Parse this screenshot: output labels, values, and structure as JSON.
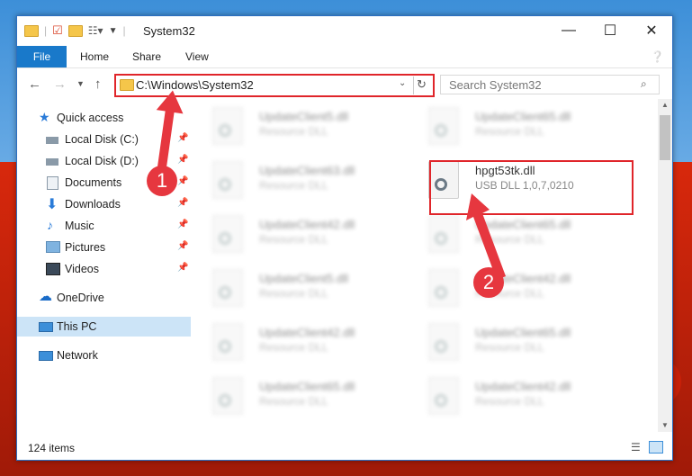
{
  "window": {
    "title": "System32",
    "controls": {
      "minimize": "—",
      "maximize": "☐",
      "close": "✕"
    }
  },
  "ribbon": {
    "tabs": [
      "File",
      "Home",
      "Share",
      "View"
    ]
  },
  "address": {
    "path": "C:\\Windows\\System32",
    "search_placeholder": "Search System32"
  },
  "sidebar": {
    "items": [
      {
        "label": "Quick access",
        "icon": "star-icon"
      },
      {
        "label": "Local Disk (C:)",
        "icon": "drive-icon"
      },
      {
        "label": "Local Disk (D:)",
        "icon": "drive-icon"
      },
      {
        "label": "Documents",
        "icon": "documents-icon"
      },
      {
        "label": "Downloads",
        "icon": "download-icon"
      },
      {
        "label": "Music",
        "icon": "music-icon"
      },
      {
        "label": "Pictures",
        "icon": "pictures-icon"
      },
      {
        "label": "Videos",
        "icon": "videos-icon"
      },
      {
        "label": "OneDrive",
        "icon": "cloud-icon"
      },
      {
        "label": "This PC",
        "icon": "computer-icon"
      },
      {
        "label": "Network",
        "icon": "network-icon"
      }
    ]
  },
  "files": [
    {
      "name": "UpdateClient5.dll",
      "type": "Resource DLL"
    },
    {
      "name": "UpdateClient65.dll",
      "type": "Resource DLL"
    },
    {
      "name": "UpdateClient63.dll",
      "type": "Resource DLL"
    },
    {
      "name": "hpgt53tk.dll",
      "type": "USB DLL 1,0,7,0210"
    },
    {
      "name": "UpdateClient42.dll",
      "type": "Resource DLL"
    },
    {
      "name": "UpdateClient65.dll",
      "type": "Resource DLL"
    },
    {
      "name": "UpdateClient5.dll",
      "type": "Resource DLL"
    },
    {
      "name": "UpdateClient42.dll",
      "type": "Resource DLL"
    },
    {
      "name": "UpdateClient42.dll",
      "type": "Resource DLL"
    },
    {
      "name": "UpdateClient65.dll",
      "type": "Resource DLL"
    },
    {
      "name": "UpdateClient65.dll",
      "type": "Resource DLL"
    },
    {
      "name": "UpdateClient42.dll",
      "type": "Resource DLL"
    }
  ],
  "status": {
    "item_count": "124 items"
  },
  "annotations": {
    "step1": "1",
    "step2": "2"
  },
  "colors": {
    "accent": "#1979ca",
    "annotation": "#e6373f"
  }
}
